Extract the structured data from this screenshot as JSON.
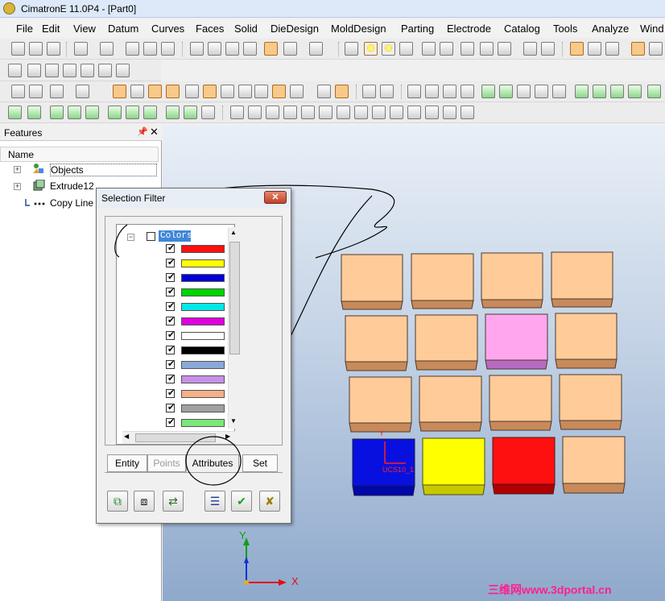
{
  "window": {
    "title": "CimatronE 11.0P4 - [Part0]"
  },
  "menu": [
    "File",
    "Edit",
    "View",
    "Datum",
    "Curves",
    "Faces",
    "Solid",
    "DieDesign",
    "MoldDesign",
    "Parting",
    "Electrode",
    "Catalog",
    "Tools",
    "Analyze",
    "Wind"
  ],
  "features_panel": {
    "title": "Features",
    "column_header": "Name",
    "items": [
      "Objects",
      "Extrude12",
      "Copy Line"
    ]
  },
  "selection_filter": {
    "title": "Selection Filter",
    "root_label": "Colors",
    "colors": [
      "#ff1010",
      "#ffff00",
      "#0000d8",
      "#00d400",
      "#00e8e8",
      "#e000e0",
      "#ffffff",
      "#000000",
      "#8aa8d8",
      "#c890e8",
      "#f4b088",
      "#a0a0a0",
      "#7ae87a"
    ],
    "tabs": [
      "Entity",
      "Points",
      "Attributes",
      "Set"
    ]
  },
  "ucs_label": "UCS10_1",
  "axes": {
    "x": "X",
    "y": "Y"
  },
  "watermark": "三维网www.3dportal.cn"
}
